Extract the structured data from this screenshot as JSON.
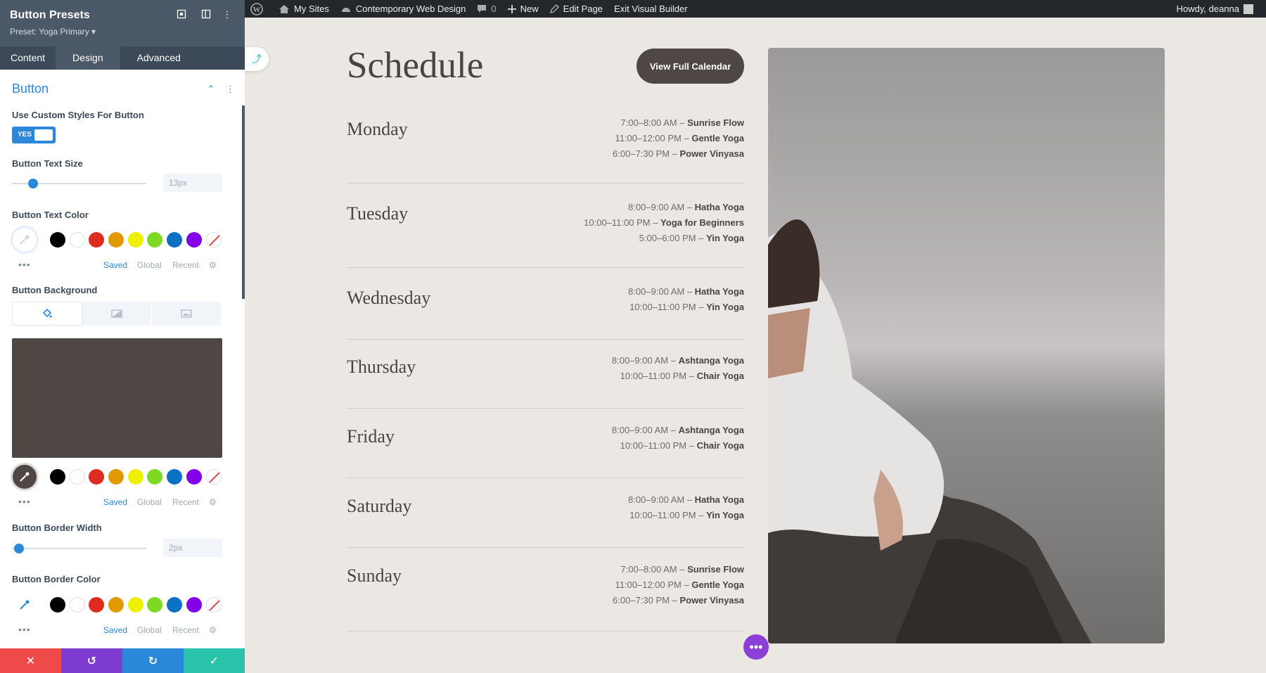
{
  "admin_bar": {
    "items": [
      "My Sites",
      "Contemporary Web Design",
      "0",
      "New",
      "Edit Page",
      "Exit Visual Builder"
    ],
    "howdy": "Howdy, deanna"
  },
  "panel": {
    "title": "Button Presets",
    "preset": "Preset: Yoga Primary ▾",
    "tabs": [
      "Content",
      "Design",
      "Advanced"
    ],
    "section_title": "Button",
    "custom_styles_label": "Use Custom Styles For Button",
    "toggle_label": "YES",
    "text_size_label": "Button Text Size",
    "text_size_value": "13px",
    "text_color_label": "Button Text Color",
    "background_label": "Button Background",
    "border_width_label": "Button Border Width",
    "border_width_value": "2px",
    "border_color_label": "Button Border Color",
    "palette_links": {
      "saved": "Saved",
      "global": "Global",
      "recent": "Recent"
    },
    "palette_colors": [
      "#000000",
      "#ffffff",
      "#e02b20",
      "#e09900",
      "#edf000",
      "#7cda24",
      "#0c71c3",
      "#8300e9"
    ],
    "background_color": "#4f4743",
    "footer_colors": [
      "#ef4a4a",
      "#7e3bd0",
      "#2b87da",
      "#29c4a9"
    ]
  },
  "page": {
    "heading": "Schedule",
    "button_label": "View Full Calendar",
    "days": [
      {
        "name": "Monday",
        "classes": [
          {
            "time": "7:00–8:00 AM – ",
            "name": "Sunrise Flow"
          },
          {
            "time": "11:00–12:00 PM – ",
            "name": "Gentle Yoga"
          },
          {
            "time": "6:00–7:30 PM – ",
            "name": "Power Vinyasa"
          }
        ]
      },
      {
        "name": "Tuesday",
        "classes": [
          {
            "time": "8:00–9:00 AM – ",
            "name": "Hatha Yoga"
          },
          {
            "time": "10:00–11:00 PM – ",
            "name": "Yoga for Beginners"
          },
          {
            "time": "5:00–6:00 PM – ",
            "name": "Yin Yoga"
          }
        ]
      },
      {
        "name": "Wednesday",
        "classes": [
          {
            "time": "8:00–9:00 AM – ",
            "name": "Hatha Yoga"
          },
          {
            "time": "10:00–11:00 PM – ",
            "name": "Yin Yoga"
          }
        ]
      },
      {
        "name": "Thursday",
        "classes": [
          {
            "time": "8:00–9:00 AM – ",
            "name": "Ashtanga Yoga"
          },
          {
            "time": "10:00–11:00 PM – ",
            "name": "Chair Yoga"
          }
        ]
      },
      {
        "name": "Friday",
        "classes": [
          {
            "time": "8:00–9:00 AM – ",
            "name": "Ashtanga Yoga"
          },
          {
            "time": "10:00–11:00 PM – ",
            "name": "Chair Yoga"
          }
        ]
      },
      {
        "name": "Saturday",
        "classes": [
          {
            "time": "8:00–9:00 AM – ",
            "name": "Hatha Yoga"
          },
          {
            "time": "10:00–11:00 PM – ",
            "name": "Yin Yoga"
          }
        ]
      },
      {
        "name": "Sunday",
        "classes": [
          {
            "time": "7:00–8:00 AM – ",
            "name": "Sunrise Flow"
          },
          {
            "time": "11:00–12:00 PM – ",
            "name": "Gentle Yoga"
          },
          {
            "time": "6:00–7:30 PM – ",
            "name": "Power Vinyasa"
          }
        ]
      }
    ]
  }
}
